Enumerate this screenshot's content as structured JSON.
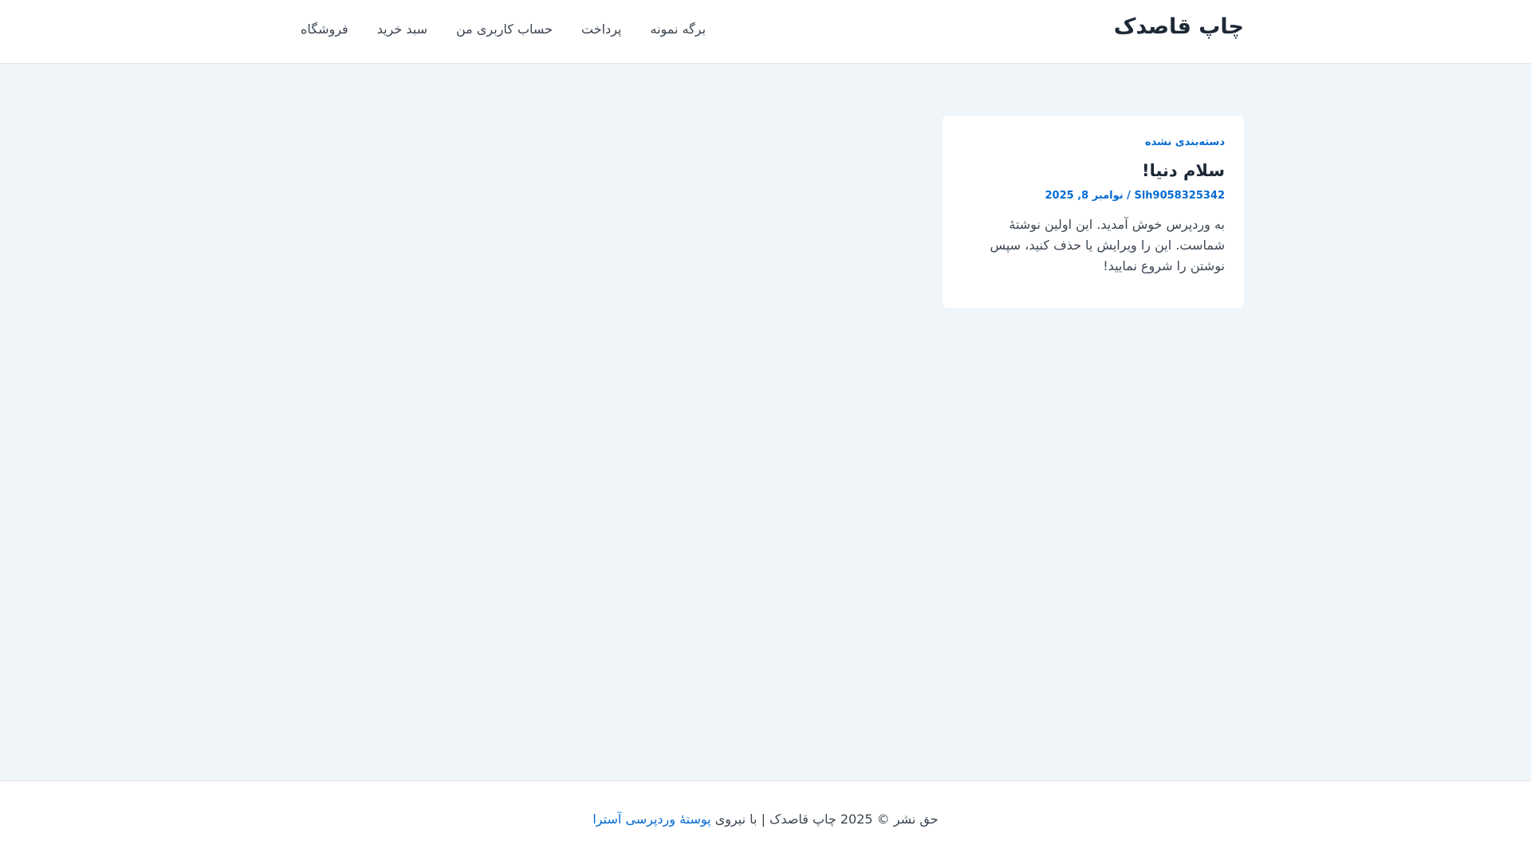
{
  "header": {
    "site_title": "چاپ قاصدک",
    "nav": [
      "برگه نمونه",
      "پرداخت",
      "حساب کاربری من",
      "سبد خرید",
      "فروشگاه"
    ]
  },
  "post": {
    "category": "دسته‌بندی نشده",
    "title": "سلام دنیا!",
    "meta": "Slh9058325342 / نوامبر 8, 2025",
    "excerpt": "به وردپرس خوش آمدید. این اولین نوشتهٔ شماست. این را ویرایش یا حذف کنید، سپس نوشتن را شروع نمایید!"
  },
  "footer": {
    "text": "حق نشر © 2025 چاپ قاصدک | با نیروی ",
    "link": "پوستهٔ وردپرسی آسترا"
  },
  "colors": {
    "accent": "#046bd2",
    "background": "#f0f5fa"
  }
}
